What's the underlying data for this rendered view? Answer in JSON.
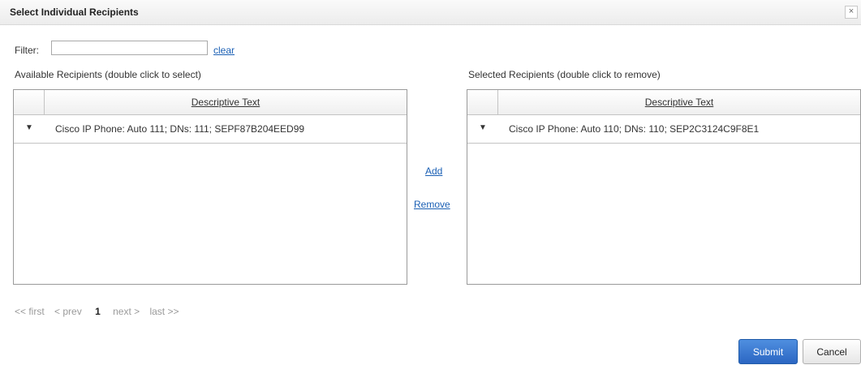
{
  "dialog": {
    "title": "Select Individual Recipients",
    "close_label": "×"
  },
  "filter": {
    "label": "Filter:",
    "value": "",
    "placeholder": "",
    "clear_label": "clear"
  },
  "available": {
    "label": "Available Recipients (double click to select)",
    "column_header": "Descriptive Text",
    "rows": [
      {
        "marker": "▼",
        "text": "Cisco IP Phone: Auto 111; DNs: 111; SEPF87B204EED99"
      }
    ]
  },
  "selected": {
    "label": "Selected Recipients (double click to remove)",
    "column_header": "Descriptive Text",
    "rows": [
      {
        "marker": "▼",
        "text": "Cisco IP Phone: Auto 110; DNs: 110; SEP2C3124C9F8E1"
      }
    ]
  },
  "actions": {
    "add_label": "Add",
    "remove_label": "Remove"
  },
  "pager": {
    "first": "<< first",
    "prev": "< prev",
    "current": "1",
    "next": "next >",
    "last": "last >>"
  },
  "buttons": {
    "submit": "Submit",
    "cancel": "Cancel"
  }
}
